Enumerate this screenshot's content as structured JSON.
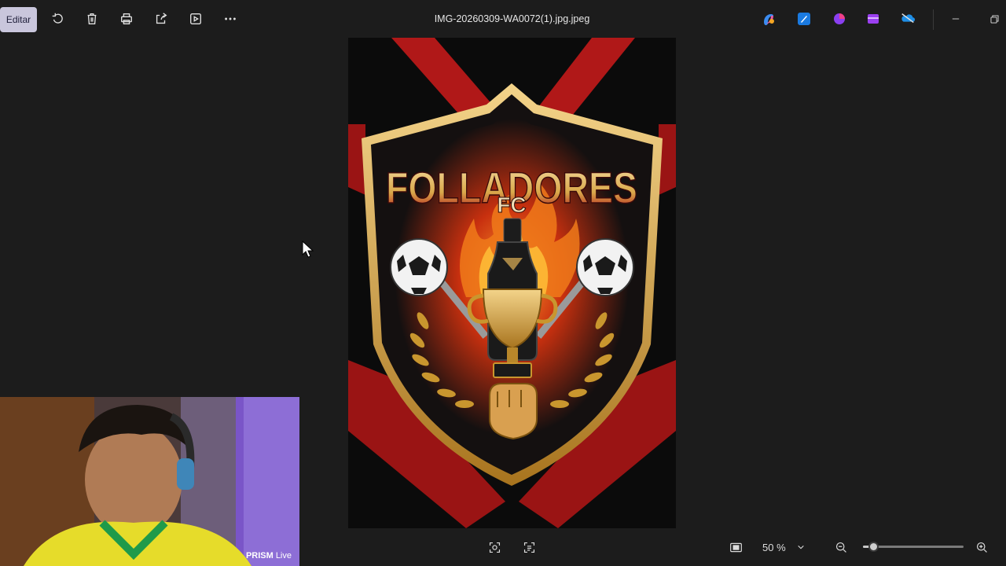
{
  "toolbar": {
    "edit_label": "Editar",
    "actions": [
      "rotate-icon",
      "delete-icon",
      "print-icon",
      "share-icon",
      "slideshow-icon",
      "more-icon"
    ]
  },
  "file": {
    "name": "IMG-20260309-WA0072(1).jpg.jpeg"
  },
  "app_icons": [
    "copilot-icon",
    "designer-icon",
    "clipchamp-icon",
    "video-editor-icon",
    "onedrive-icon"
  ],
  "image": {
    "crest_title": "FOLLADORES",
    "crest_subtitle": "FC",
    "colors": {
      "red": "#b01818",
      "gold": "#d9a84a",
      "dark": "#0c0c0c",
      "flame": "#f07a1a"
    }
  },
  "webcam": {
    "brand": "PRISM",
    "suffix": "Live"
  },
  "zoom": {
    "value": "50 %",
    "level": 0.1
  }
}
